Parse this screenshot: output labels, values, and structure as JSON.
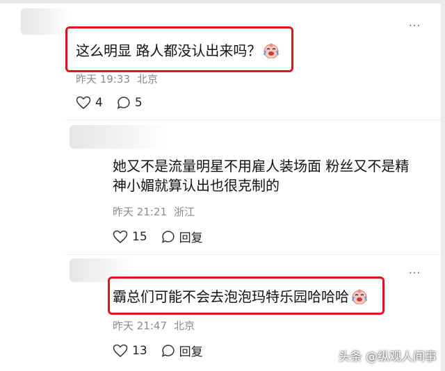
{
  "comments": [
    {
      "text": "这么明显 路人都没认出来吗？",
      "date": "昨天 19:33",
      "location": "北京",
      "likes": "4",
      "replies": "5",
      "highlighted": true
    },
    {
      "text_line1": "她又不是流量明星不用雇人装场面 粉丝又不是精",
      "text_line2": "神小媚就算认出也很克制的",
      "date": "昨天 21:21",
      "location": "浙江",
      "likes": "15",
      "reply_label": "回复",
      "highlighted": false
    },
    {
      "text": "霸总们可能不会去泡泡玛特乐园哈哈哈",
      "date": "昨天 21:47",
      "location": "北京",
      "likes": "13",
      "reply_label": "回复",
      "highlighted": true
    }
  ],
  "more_glyph": "···",
  "watermark": "头条 @纵观人间事",
  "colors": {
    "highlight": "#e1131b",
    "meta": "#8a8a8a"
  },
  "icons": {
    "like": "heart-outline-icon",
    "comment": "speech-bubble-icon",
    "emoji": "crying-laughing-emoji-icon"
  }
}
